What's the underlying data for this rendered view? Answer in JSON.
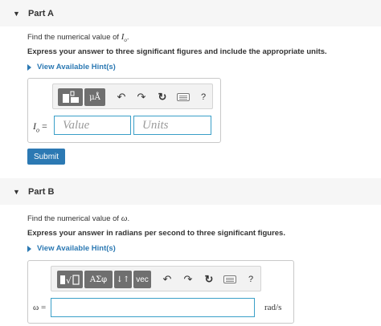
{
  "part_a": {
    "header": "Part A",
    "prompt_text": "Find the numerical value of ",
    "prompt_var": "I",
    "prompt_var_sub": "o",
    "prompt_end": ".",
    "instruction": "Express your answer to three significant figures and include the appropriate units.",
    "hint_label": "View Available Hint(s)",
    "toolbar": {
      "templates_icon": "templates-icon",
      "units_button": "μÅ",
      "undo": "↶",
      "redo": "↷",
      "reset": "↻",
      "keyboard_icon": "keyboard-icon",
      "help": "?"
    },
    "field_label_var": "I",
    "field_label_sub": "o",
    "field_label_eq": " =",
    "value_placeholder": "Value",
    "units_placeholder": "Units",
    "submit_label": "Submit"
  },
  "part_b": {
    "header": "Part B",
    "prompt_text": "Find the numerical value of ",
    "prompt_var": "ω",
    "prompt_end": ".",
    "instruction": "Express your answer in radians per second to three significant figures.",
    "hint_label": "View Available Hint(s)",
    "toolbar": {
      "templates_icon": "templates-icon",
      "greek_button": "ΑΣφ",
      "arrows_button": "↓↑",
      "vec_button": "vec",
      "undo": "↶",
      "redo": "↷",
      "reset": "↻",
      "keyboard_icon": "keyboard-icon",
      "help": "?"
    },
    "field_label": "ω =",
    "field_value": "",
    "unit": "rad/s"
  },
  "colors": {
    "accent": "#2c79b3",
    "input_border": "#3a9fc8",
    "toolbar_button": "#6f6f6f",
    "header_bg": "#f6f6f6"
  }
}
